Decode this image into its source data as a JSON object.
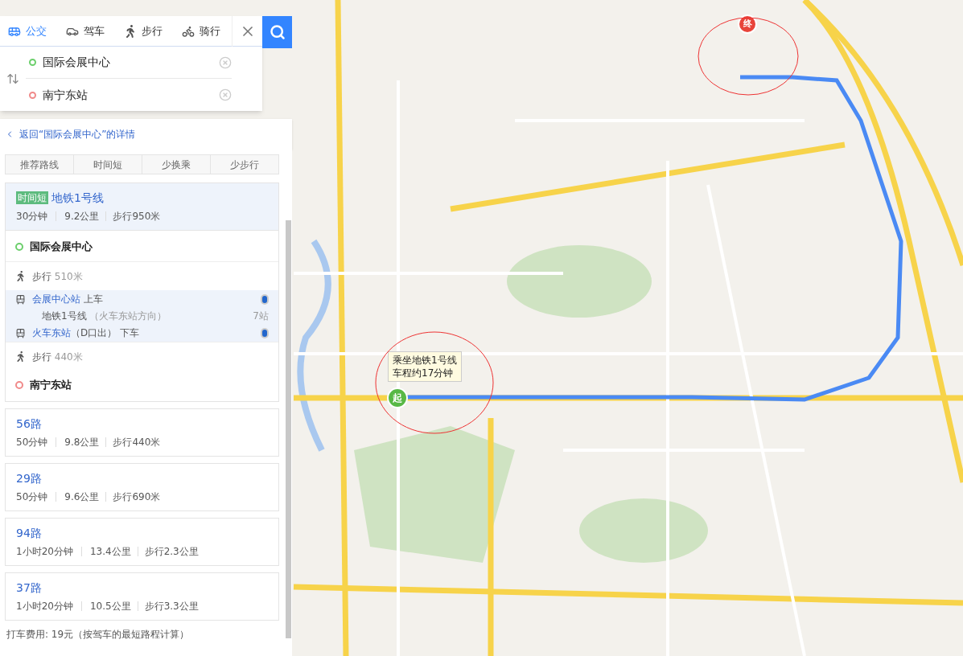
{
  "tabs": [
    {
      "label": "公交",
      "kind": "bus",
      "selected": true
    },
    {
      "label": "驾车",
      "kind": "car",
      "selected": false
    },
    {
      "label": "步行",
      "kind": "walk",
      "selected": false
    },
    {
      "label": "骑行",
      "kind": "bike",
      "selected": false
    }
  ],
  "origin": {
    "value": "国际会展中心"
  },
  "destination": {
    "value": "南宁东站"
  },
  "back_link": "返回“国际会展中心”的详情",
  "sort_tabs": [
    {
      "label": "推荐路线",
      "selected": false
    },
    {
      "label": "时间短",
      "selected": false
    },
    {
      "label": "少换乘",
      "selected": false
    },
    {
      "label": "少步行",
      "selected": false
    }
  ],
  "routes": [
    {
      "badge": "时间短",
      "name": "地铁1号线",
      "time": "30分钟",
      "distance": "9.2公里",
      "walk": "步行950米",
      "expanded": true,
      "steps": [
        {
          "kind": "start",
          "text": "国际会展中心"
        },
        {
          "kind": "walk",
          "text": "步行",
          "detail": "510米"
        },
        {
          "kind": "board",
          "station": "会展中心站",
          "action": "上车"
        },
        {
          "kind": "ride",
          "line": "地铁1号线",
          "direction": "（火车东站方向）",
          "stops": "7站"
        },
        {
          "kind": "alight",
          "station": "火车东站",
          "exit": "（D口出）",
          "action": "下车"
        },
        {
          "kind": "walk",
          "text": "步行",
          "detail": "440米"
        },
        {
          "kind": "end",
          "text": "南宁东站"
        }
      ]
    },
    {
      "name": "56路",
      "time": "50分钟",
      "distance": "9.8公里",
      "walk": "步行440米",
      "expanded": false
    },
    {
      "name": "29路",
      "time": "50分钟",
      "distance": "9.6公里",
      "walk": "步行690米",
      "expanded": false
    },
    {
      "name": "94路",
      "time": "1小时20分钟",
      "distance": "13.4公里",
      "walk": "步行2.3公里",
      "expanded": false
    },
    {
      "name": "37路",
      "time": "1小时20分钟",
      "distance": "10.5公里",
      "walk": "步行3.3公里",
      "expanded": false
    }
  ],
  "taxi_note": "打车费用: 19元（按驾车的最短路程计算）",
  "map": {
    "callout": [
      "乘坐地铁1号线",
      "车程约17分钟"
    ],
    "start_marker": "起",
    "end_marker": "终"
  }
}
